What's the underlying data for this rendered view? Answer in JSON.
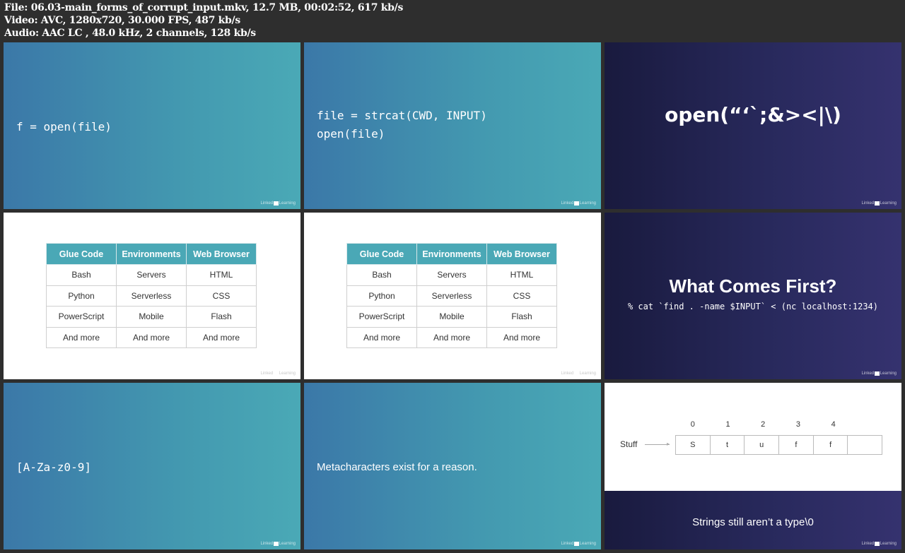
{
  "header": {
    "file_line": "File: 06.03-main_forms_of_corrupt_input.mkv, 12.7 MB, 00:02:52, 617 kb/s",
    "video_line": "Video: AVC, 1280x720, 30.000 FPS, 487 kb/s",
    "audio_line": "Audio: AAC LC , 48.0 kHz, 2 channels, 128 kb/s"
  },
  "watermark": {
    "a": "Linked",
    "b": "in",
    "c": "Learning"
  },
  "slides": {
    "s1": {
      "code": "f = open(file)"
    },
    "s2": {
      "line1": "file = strcat(CWD, INPUT)",
      "line2": "open(file)"
    },
    "s3": {
      "code": "open(“‘`;&><|\\)"
    },
    "table": {
      "headers": [
        "Glue Code",
        "Environments",
        "Web Browser"
      ],
      "rows": [
        [
          "Bash",
          "Servers",
          "HTML"
        ],
        [
          "Python",
          "Serverless",
          "CSS"
        ],
        [
          "PowerScript",
          "Mobile",
          "Flash"
        ],
        [
          "And more",
          "And more",
          "And more"
        ]
      ]
    },
    "s6": {
      "title": "What Comes First?",
      "command": "% cat `find . -name $INPUT` < (nc localhost:1234)"
    },
    "s7": {
      "code": "[A-Za-z0-9]"
    },
    "s8": {
      "text": "Metacharacters exist for a reason."
    },
    "s9": {
      "label": "Stuff",
      "indices": [
        "0",
        "1",
        "2",
        "3",
        "4"
      ],
      "cells": [
        "S",
        "t",
        "u",
        "f",
        "f",
        ""
      ],
      "caption": "Strings still aren’t a type\\0"
    }
  },
  "colors": {
    "blue": "#4399b0",
    "navy": "#28295c",
    "table_header": "#4aa8b6"
  }
}
